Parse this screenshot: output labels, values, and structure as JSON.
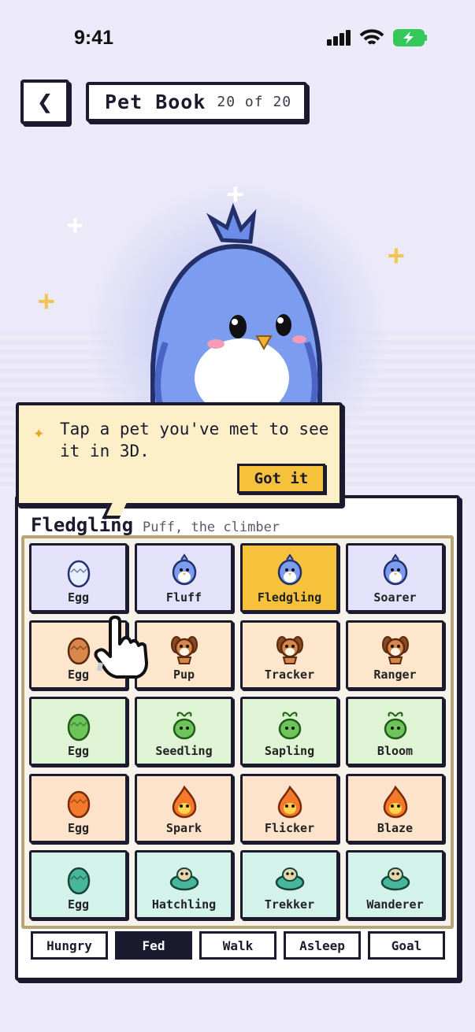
{
  "status": {
    "time": "9:41"
  },
  "header": {
    "title": "Pet Book",
    "count": "20 of 20"
  },
  "tooltip": {
    "message": "Tap a pet you've met to see it in 3D.",
    "button": "Got it"
  },
  "detail": {
    "stage": "Fledgling",
    "description": "Puff, the climber"
  },
  "colors": {
    "bird": "#e4e2fb",
    "pup": "#fde6cc",
    "plant": "#dff4d5",
    "flame": "#fde3cc",
    "turtle": "#d3f2ea",
    "selected": "#f6c23b"
  },
  "rows": [
    {
      "family": "bird",
      "cells": [
        {
          "label": "Egg",
          "icon": "bird-egg-icon"
        },
        {
          "label": "Fluff",
          "icon": "bird-fluff-icon"
        },
        {
          "label": "Fledgling",
          "icon": "bird-fledgling-icon",
          "selected": true
        },
        {
          "label": "Soarer",
          "icon": "bird-soarer-icon"
        }
      ]
    },
    {
      "family": "pup",
      "cells": [
        {
          "label": "Egg",
          "icon": "pup-egg-icon"
        },
        {
          "label": "Pup",
          "icon": "pup-icon"
        },
        {
          "label": "Tracker",
          "icon": "tracker-dog-icon"
        },
        {
          "label": "Ranger",
          "icon": "ranger-fox-icon"
        }
      ]
    },
    {
      "family": "plant",
      "cells": [
        {
          "label": "Egg",
          "icon": "plant-egg-icon"
        },
        {
          "label": "Seedling",
          "icon": "seedling-icon"
        },
        {
          "label": "Sapling",
          "icon": "sapling-icon"
        },
        {
          "label": "Bloom",
          "icon": "bloom-icon"
        }
      ]
    },
    {
      "family": "flame",
      "cells": [
        {
          "label": "Egg",
          "icon": "flame-egg-icon"
        },
        {
          "label": "Spark",
          "icon": "spark-icon"
        },
        {
          "label": "Flicker",
          "icon": "flicker-icon"
        },
        {
          "label": "Blaze",
          "icon": "blaze-icon"
        }
      ]
    },
    {
      "family": "turtle",
      "cells": [
        {
          "label": "Egg",
          "icon": "turtle-egg-icon"
        },
        {
          "label": "Hatchling",
          "icon": "hatchling-icon"
        },
        {
          "label": "Trekker",
          "icon": "trekker-icon"
        },
        {
          "label": "Wanderer",
          "icon": "wanderer-icon"
        }
      ]
    }
  ],
  "tabs": [
    {
      "label": "Hungry"
    },
    {
      "label": "Fed",
      "active": true
    },
    {
      "label": "Walk"
    },
    {
      "label": "Asleep"
    },
    {
      "label": "Goal"
    }
  ]
}
